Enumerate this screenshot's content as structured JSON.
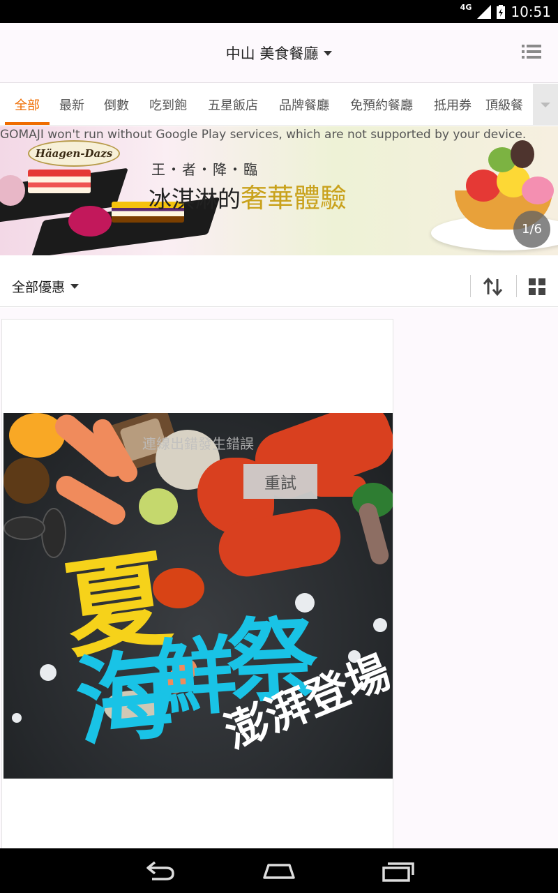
{
  "status_bar": {
    "network": "4G",
    "time": "10:51"
  },
  "app_bar": {
    "location": "中山",
    "category": "美食餐廳",
    "title": "中山 美食餐廳"
  },
  "tabs": [
    {
      "label": "全部",
      "active": true
    },
    {
      "label": "最新"
    },
    {
      "label": "倒數"
    },
    {
      "label": "吃到飽"
    },
    {
      "label": "五星飯店"
    },
    {
      "label": "品牌餐廳"
    },
    {
      "label": "免預約餐廳"
    },
    {
      "label": "抵用券"
    },
    {
      "label": "頂級餐"
    }
  ],
  "banner": {
    "system_message": "GOMAJI won't run without Google Play services, which are not supported by your device.",
    "brand": "Häagen-Dazs",
    "subtitle": "王・者・降・臨",
    "title_prefix": "冰淇淋的",
    "title_highlight": "奢華",
    "title_suffix": "體驗",
    "counter": "1/6"
  },
  "filter_bar": {
    "label": "全部優惠"
  },
  "card": {
    "image_text_big_1": "夏",
    "image_text_big_2": "海",
    "image_text_big_3": "鮮",
    "image_text_big_4": "祭",
    "image_text_small": "澎湃登場",
    "error_message": "連線出錯發生錯誤",
    "retry_label": "重試"
  },
  "colors": {
    "accent": "#ef6c00",
    "status_bar": "#000000",
    "app_bar": "#fdf9fd"
  },
  "icons": [
    "signal-icon",
    "battery-icon",
    "dropdown-caret-icon",
    "list-menu-icon",
    "sort-icon",
    "grid-view-icon",
    "back-icon",
    "home-icon",
    "recents-icon"
  ]
}
